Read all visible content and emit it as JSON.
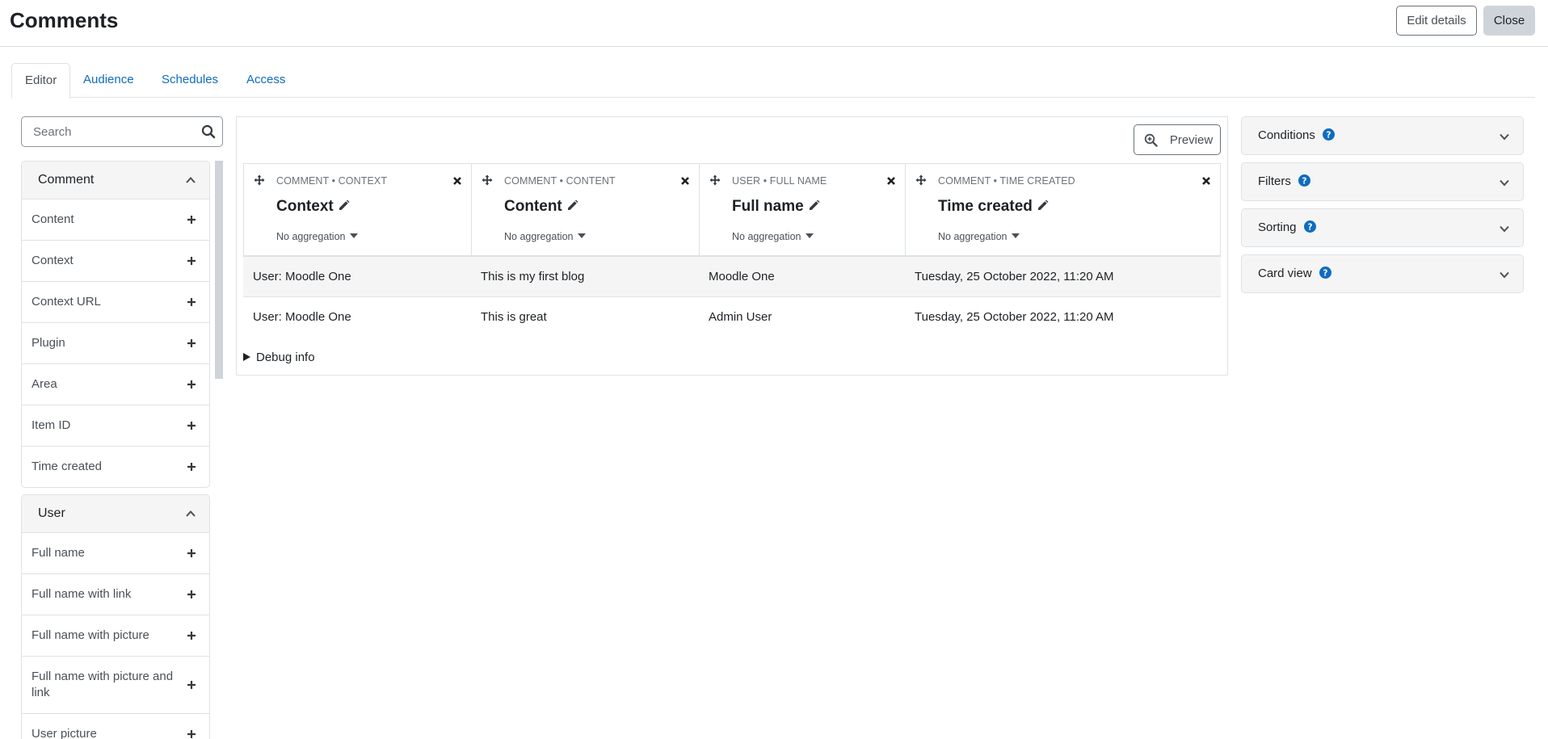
{
  "page": {
    "title": "Comments",
    "edit_details_label": "Edit details",
    "close_label": "Close"
  },
  "tabs": [
    {
      "label": "Editor",
      "active": true
    },
    {
      "label": "Audience",
      "active": false
    },
    {
      "label": "Schedules",
      "active": false
    },
    {
      "label": "Access",
      "active": false
    }
  ],
  "sidebar": {
    "search_placeholder": "Search",
    "groups": [
      {
        "title": "Comment",
        "expanded": true,
        "items": [
          "Content",
          "Context",
          "Context URL",
          "Plugin",
          "Area",
          "Item ID",
          "Time created"
        ]
      },
      {
        "title": "User",
        "expanded": true,
        "items": [
          "Full name",
          "Full name with link",
          "Full name with picture",
          "Full name with picture and link",
          "User picture"
        ]
      }
    ]
  },
  "editor": {
    "preview_label": "Preview",
    "columns": [
      {
        "kicker": "Comment • Context",
        "title": "Context",
        "aggregation": "No aggregation"
      },
      {
        "kicker": "Comment • Content",
        "title": "Content",
        "aggregation": "No aggregation"
      },
      {
        "kicker": "User • Full name",
        "title": "Full name",
        "aggregation": "No aggregation"
      },
      {
        "kicker": "Comment • Time created",
        "title": "Time created",
        "aggregation": "No aggregation"
      }
    ],
    "rows": [
      [
        "User: Moodle One",
        "This is my first blog",
        "Moodle One",
        "Tuesday, 25 October 2022, 11:20 AM"
      ],
      [
        "User: Moodle One",
        "This is great",
        "Admin User",
        "Tuesday, 25 October 2022, 11:20 AM"
      ]
    ],
    "debug_label": "Debug info"
  },
  "settings": [
    {
      "label": "Conditions"
    },
    {
      "label": "Filters"
    },
    {
      "label": "Sorting"
    },
    {
      "label": "Card view"
    }
  ],
  "colors": {
    "link": "#0f6cbf",
    "help_icon": "#0f6cbf",
    "border": "#dee2e6",
    "card_bg": "#f5f5f5"
  }
}
